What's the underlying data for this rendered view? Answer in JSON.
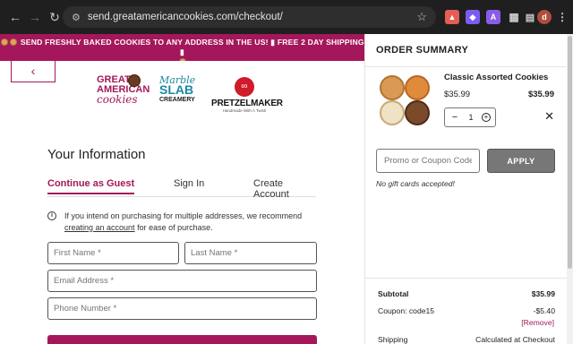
{
  "browser": {
    "url": "send.greatamericancookies.com/checkout/",
    "back_icon": "arrow-left-icon",
    "forward_icon": "arrow-right-icon",
    "reload_icon": "reload-icon",
    "extensions": [
      {
        "name": "brave-shield-icon",
        "color": "#e45e57"
      },
      {
        "name": "shield-icon",
        "color": "#7b5cf0"
      },
      {
        "name": "a-extension-icon",
        "color": "#8a5ce8",
        "letter": "A"
      },
      {
        "name": "puzzle-icon",
        "color": "#2e2e2e"
      },
      {
        "name": "profile-avatar",
        "color": "#b04c3c",
        "letter": "d"
      }
    ]
  },
  "banner": {
    "text_line1": "SEND FRESHLY BAKED COOKIES TO ANY ADDRESS IN THE US! ",
    "text_line1b": " FREE 2 DAY SHIPPING ",
    "color": "#a4185b"
  },
  "brands": {
    "gac": {
      "line1": "GREAT",
      "line2": "AMERICAN",
      "line3": "cookies"
    },
    "marble": {
      "line1": "Marble",
      "line2": "SLAB",
      "line3": "CREAMERY"
    },
    "pretzel": {
      "name": "PRETZELMAKER",
      "tagline": "Handmade With A Twist!"
    }
  },
  "form": {
    "title": "Your Information",
    "tabs": [
      {
        "label": "Continue as Guest",
        "active": true
      },
      {
        "label": "Sign In",
        "active": false
      },
      {
        "label": "Create Account",
        "active": false
      }
    ],
    "info_text_before": "If you intend on purchasing for multiple addresses, we recommend ",
    "info_link": "creating an account",
    "info_text_after": " for ease of purchase.",
    "first_name_placeholder": "First Name *",
    "last_name_placeholder": "Last Name *",
    "email_placeholder": "Email Address *",
    "phone_placeholder": "Phone Number *"
  },
  "summary": {
    "title": "ORDER SUMMARY",
    "product": {
      "name": "Classic Assorted Cookies",
      "price": "$35.99",
      "total": "$35.99",
      "quantity": "1"
    },
    "promo_placeholder": "Promo or Coupon Code",
    "apply_label": "APPLY",
    "no_gift": "No gift cards accepted!",
    "subtotal_label": "Subtotal",
    "subtotal_value": "$35.99",
    "coupon_label": "Coupon: code15",
    "coupon_value": "-$5.40",
    "remove_label": "[Remove]",
    "shipping_label": "Shipping",
    "shipping_value": "Calculated at Checkout"
  },
  "colors": {
    "brand": "#a4185b",
    "chrome_bg": "#1f1f1f"
  }
}
